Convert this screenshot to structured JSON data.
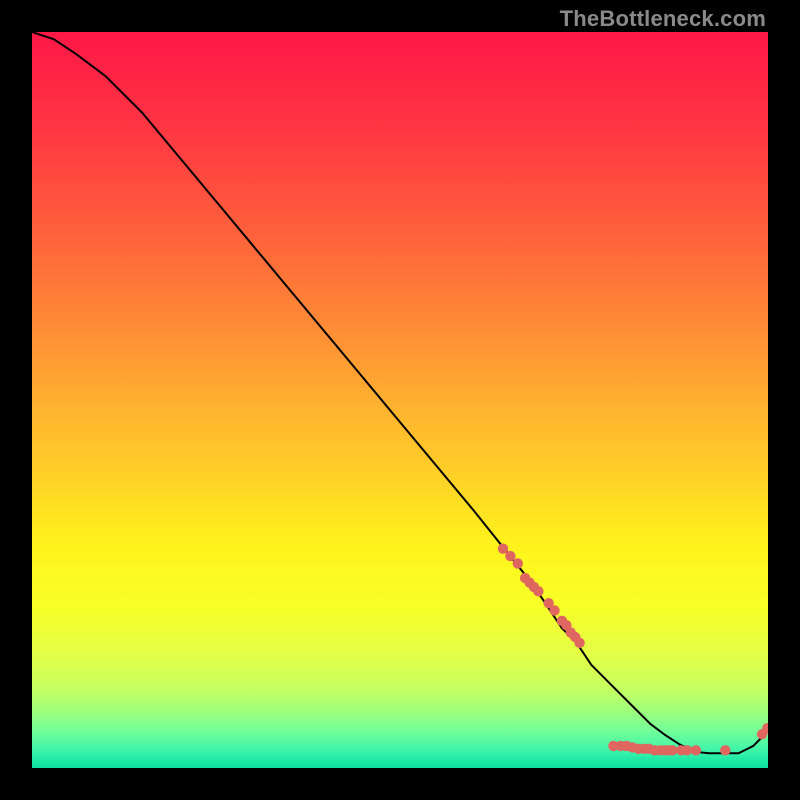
{
  "watermark": "TheBottleneck.com",
  "chart_data": {
    "type": "line",
    "title": "",
    "xlabel": "",
    "ylabel": "",
    "xlim": [
      0,
      100
    ],
    "ylim": [
      0,
      100
    ],
    "grid": false,
    "legend": false,
    "series": [
      {
        "name": "bottleneck-curve",
        "color": "#000000",
        "x": [
          0,
          3,
          6,
          10,
          15,
          20,
          25,
          30,
          35,
          40,
          45,
          50,
          55,
          60,
          64,
          68,
          70,
          72,
          74,
          76,
          78,
          80,
          82,
          84,
          86,
          88,
          90,
          92,
          94,
          96,
          98,
          100
        ],
        "y": [
          100,
          99,
          97,
          94,
          89,
          83,
          77,
          71,
          65,
          59,
          53,
          47,
          41,
          35,
          30,
          25,
          22,
          19,
          17,
          14,
          12,
          10,
          8,
          6,
          4.5,
          3.2,
          2.2,
          2,
          2,
          2,
          3,
          5
        ]
      },
      {
        "name": "highlight-points",
        "color": "#e06660",
        "type": "scatter",
        "x": [
          64,
          65,
          66,
          67,
          67.6,
          68.2,
          68.8,
          70.2,
          71,
          72,
          72.6,
          73.2,
          73.8,
          74.4,
          79,
          80,
          80.8,
          81.6,
          82.4,
          83.2,
          83.8,
          84.6,
          85.4,
          86,
          86.6,
          87,
          88.2,
          89,
          90.2,
          94.2,
          99.2,
          99.9
        ],
        "y": [
          29.8,
          28.8,
          27.8,
          25.8,
          25.2,
          24.6,
          24.0,
          22.4,
          21.4,
          20.0,
          19.4,
          18.4,
          17.8,
          17.0,
          3.0,
          3.0,
          3.0,
          2.8,
          2.6,
          2.6,
          2.6,
          2.4,
          2.4,
          2.4,
          2.4,
          2.4,
          2.4,
          2.4,
          2.4,
          2.4,
          4.6,
          5.4
        ]
      }
    ],
    "background_gradient_stops": [
      {
        "offset": 0.0,
        "color": "#ff1846"
      },
      {
        "offset": 0.1,
        "color": "#ff2e44"
      },
      {
        "offset": 0.2,
        "color": "#ff4a3f"
      },
      {
        "offset": 0.3,
        "color": "#ff6a3a"
      },
      {
        "offset": 0.4,
        "color": "#ff8b36"
      },
      {
        "offset": 0.5,
        "color": "#ffaf30"
      },
      {
        "offset": 0.6,
        "color": "#ffd027"
      },
      {
        "offset": 0.7,
        "color": "#fff41c"
      },
      {
        "offset": 0.78,
        "color": "#f7ff27"
      },
      {
        "offset": 0.84,
        "color": "#e5ff44"
      },
      {
        "offset": 0.89,
        "color": "#c8ff5e"
      },
      {
        "offset": 0.92,
        "color": "#a2ff7a"
      },
      {
        "offset": 0.95,
        "color": "#72ff99"
      },
      {
        "offset": 0.975,
        "color": "#40f5a8"
      },
      {
        "offset": 0.99,
        "color": "#1de9a7"
      },
      {
        "offset": 1.0,
        "color": "#0fdc9f"
      }
    ]
  }
}
